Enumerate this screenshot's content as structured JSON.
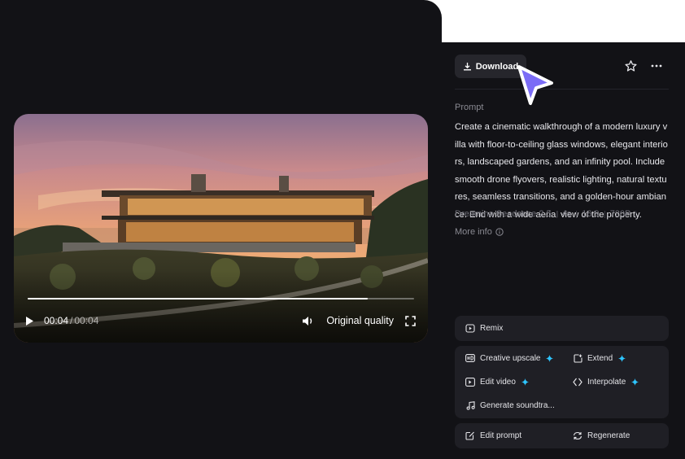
{
  "video": {
    "current_time": "00:04",
    "separator": "/",
    "total_time": "00:04",
    "progress": 0.88,
    "quality_label": "Original quality"
  },
  "header": {
    "download_label": "Download"
  },
  "prompt": {
    "label": "Prompt",
    "text": "Create a cinematic walkthrough of a modern luxury villa with floor-to-ceiling glass windows, elegant interiors, landscaped gardens, and an infinity pool. Include smooth drone flyovers, realistic lighting, natural textures, seamless transitions, and a golden-hour ambiance. End with a wide aerial view of the property."
  },
  "meta": {
    "model": "Dreamina Seedance 2.5",
    "duration": "4s",
    "ratio": "16:9",
    "resolution": "720P"
  },
  "more_info_label": "More info",
  "actions": {
    "remix": "Remix",
    "creative_upscale": "Creative upscale",
    "extend": "Extend",
    "edit_video": "Edit video",
    "interpolate": "Interpolate",
    "generate_soundtrack": "Generate soundtra...",
    "edit_prompt": "Edit prompt",
    "regenerate": "Regenerate"
  },
  "colors": {
    "panel_bg": "#121216",
    "card_bg": "#1f1f25",
    "accent_spark": "#2ec5ff",
    "cursor": "#7b6cf6"
  }
}
